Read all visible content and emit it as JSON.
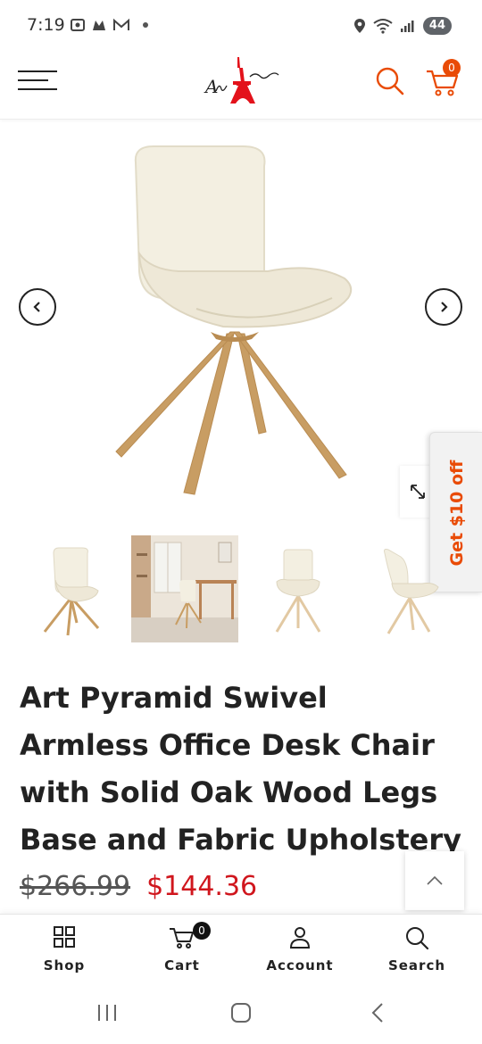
{
  "status_bar": {
    "time": "7:19",
    "battery": "44"
  },
  "header": {
    "logo_text": "Art Leon",
    "cart_count": "0"
  },
  "promo": {
    "label": "Get $10 off"
  },
  "product": {
    "title": "Art Pyramid Swivel Armless Office Desk Chair with Solid Oak Wood Legs Base and Fabric Upholstery",
    "price_original": "$266.99",
    "price_sale": "$144.36"
  },
  "colors": {
    "accent": "#e94b06",
    "sale_price": "#d0161d",
    "logo_red": "#e3121b"
  },
  "bottom_nav": {
    "items": [
      {
        "label": "Shop",
        "icon": "grid-icon"
      },
      {
        "label": "Cart",
        "icon": "cart-icon",
        "badge": "0"
      },
      {
        "label": "Account",
        "icon": "user-icon"
      },
      {
        "label": "Search",
        "icon": "search-icon"
      }
    ]
  }
}
